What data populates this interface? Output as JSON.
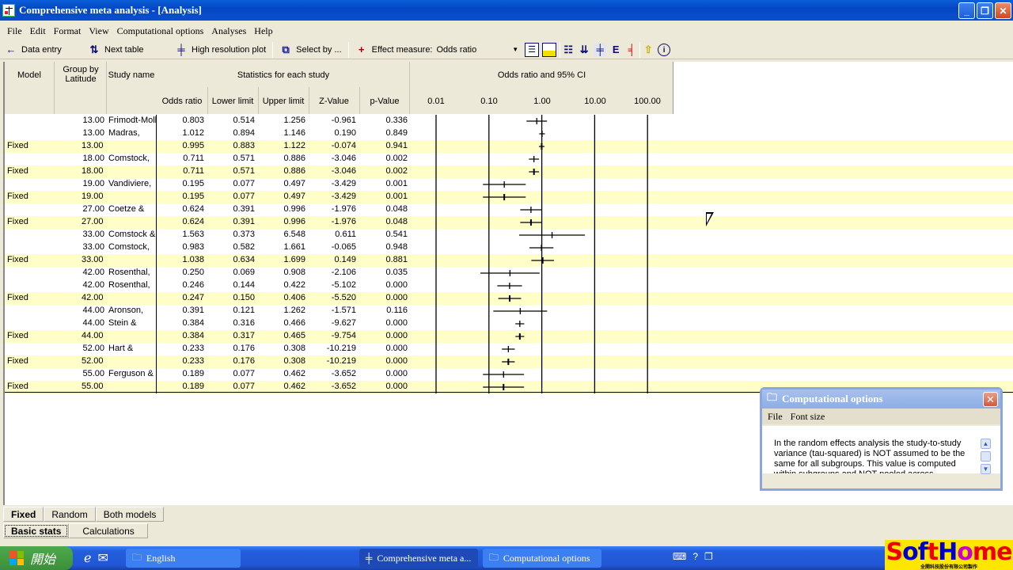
{
  "window": {
    "title": "Comprehensive meta analysis - [Analysis]"
  },
  "menu": [
    "File",
    "Edit",
    "Format",
    "View",
    "Computational options",
    "Analyses",
    "Help"
  ],
  "toolbar": {
    "data_entry": "Data entry",
    "next_table": "Next table",
    "high_res_plot": "High resolution plot",
    "select_by": "Select by ...",
    "effect_measure_label": "Effect measure:",
    "effect_measure_value": "Odds ratio"
  },
  "table": {
    "headers": {
      "model": "Model",
      "group": "Group by Latitude",
      "study": "Study name",
      "stats_group": "Statistics for each study",
      "odds_ratio": "Odds ratio",
      "lower": "Lower limit",
      "upper": "Upper limit",
      "z": "Z-Value",
      "p": "p-Value",
      "plot_title": "Odds ratio and 95% CI"
    },
    "axis_ticks": [
      "0.01",
      "0.10",
      "1.00",
      "10.00",
      "100.00"
    ],
    "rows": [
      {
        "model": "",
        "group": "13.00",
        "study": "Frimodt-Moll",
        "or": "0.803",
        "lo": "0.514",
        "hi": "1.256",
        "z": "-0.961",
        "p": "0.336"
      },
      {
        "model": "",
        "group": "13.00",
        "study": "Madras,",
        "or": "1.012",
        "lo": "0.894",
        "hi": "1.146",
        "z": "0.190",
        "p": "0.849"
      },
      {
        "model": "Fixed",
        "group": "13.00",
        "study": "",
        "or": "0.995",
        "lo": "0.883",
        "hi": "1.122",
        "z": "-0.074",
        "p": "0.941"
      },
      {
        "model": "",
        "group": "18.00",
        "study": "Comstock,",
        "or": "0.711",
        "lo": "0.571",
        "hi": "0.886",
        "z": "-3.046",
        "p": "0.002"
      },
      {
        "model": "Fixed",
        "group": "18.00",
        "study": "",
        "or": "0.711",
        "lo": "0.571",
        "hi": "0.886",
        "z": "-3.046",
        "p": "0.002"
      },
      {
        "model": "",
        "group": "19.00",
        "study": "Vandiviere,",
        "or": "0.195",
        "lo": "0.077",
        "hi": "0.497",
        "z": "-3.429",
        "p": "0.001"
      },
      {
        "model": "Fixed",
        "group": "19.00",
        "study": "",
        "or": "0.195",
        "lo": "0.077",
        "hi": "0.497",
        "z": "-3.429",
        "p": "0.001"
      },
      {
        "model": "",
        "group": "27.00",
        "study": "Coetze &",
        "or": "0.624",
        "lo": "0.391",
        "hi": "0.996",
        "z": "-1.976",
        "p": "0.048"
      },
      {
        "model": "Fixed",
        "group": "27.00",
        "study": "",
        "or": "0.624",
        "lo": "0.391",
        "hi": "0.996",
        "z": "-1.976",
        "p": "0.048"
      },
      {
        "model": "",
        "group": "33.00",
        "study": "Comstock &",
        "or": "1.563",
        "lo": "0.373",
        "hi": "6.548",
        "z": "0.611",
        "p": "0.541"
      },
      {
        "model": "",
        "group": "33.00",
        "study": "Comstock,",
        "or": "0.983",
        "lo": "0.582",
        "hi": "1.661",
        "z": "-0.065",
        "p": "0.948"
      },
      {
        "model": "Fixed",
        "group": "33.00",
        "study": "",
        "or": "1.038",
        "lo": "0.634",
        "hi": "1.699",
        "z": "0.149",
        "p": "0.881"
      },
      {
        "model": "",
        "group": "42.00",
        "study": "Rosenthal,",
        "or": "0.250",
        "lo": "0.069",
        "hi": "0.908",
        "z": "-2.106",
        "p": "0.035"
      },
      {
        "model": "",
        "group": "42.00",
        "study": "Rosenthal,",
        "or": "0.246",
        "lo": "0.144",
        "hi": "0.422",
        "z": "-5.102",
        "p": "0.000"
      },
      {
        "model": "Fixed",
        "group": "42.00",
        "study": "",
        "or": "0.247",
        "lo": "0.150",
        "hi": "0.406",
        "z": "-5.520",
        "p": "0.000"
      },
      {
        "model": "",
        "group": "44.00",
        "study": "Aronson,",
        "or": "0.391",
        "lo": "0.121",
        "hi": "1.262",
        "z": "-1.571",
        "p": "0.116"
      },
      {
        "model": "",
        "group": "44.00",
        "study": "Stein &",
        "or": "0.384",
        "lo": "0.316",
        "hi": "0.466",
        "z": "-9.627",
        "p": "0.000"
      },
      {
        "model": "Fixed",
        "group": "44.00",
        "study": "",
        "or": "0.384",
        "lo": "0.317",
        "hi": "0.465",
        "z": "-9.754",
        "p": "0.000"
      },
      {
        "model": "",
        "group": "52.00",
        "study": "Hart &",
        "or": "0.233",
        "lo": "0.176",
        "hi": "0.308",
        "z": "-10.219",
        "p": "0.000"
      },
      {
        "model": "Fixed",
        "group": "52.00",
        "study": "",
        "or": "0.233",
        "lo": "0.176",
        "hi": "0.308",
        "z": "-10.219",
        "p": "0.000"
      },
      {
        "model": "",
        "group": "55.00",
        "study": "Ferguson &",
        "or": "0.189",
        "lo": "0.077",
        "hi": "0.462",
        "z": "-3.652",
        "p": "0.000"
      },
      {
        "model": "Fixed",
        "group": "55.00",
        "study": "",
        "or": "0.189",
        "lo": "0.077",
        "hi": "0.462",
        "z": "-3.652",
        "p": "0.000"
      }
    ]
  },
  "chart_data": {
    "type": "scatter",
    "title": "Odds ratio and 95% CI",
    "xscale": "log",
    "xlim": [
      0.01,
      100
    ],
    "x_ticks": [
      "0.01",
      "0.10",
      "1.00",
      "10.00",
      "100.00"
    ],
    "points_source": "table.rows (or, lo, hi)"
  },
  "bottom_tabs": {
    "model": [
      "Fixed",
      "Random",
      "Both models"
    ],
    "view": [
      "Basic stats",
      "Calculations"
    ]
  },
  "dialog": {
    "title": "Computational options",
    "menu": [
      "File",
      "Font size"
    ],
    "body": "In the random effects analysis the study-to-study variance (tau-squared) is NOT assumed to be the same for all subgroups.  This value is computed within subgroups and NOT pooled across"
  },
  "taskbar": {
    "start": "開始",
    "items": [
      "English",
      "Comprehensive meta a...",
      "Computational options"
    ]
  },
  "watermark": {
    "brand": "SoftHome",
    "sub": "全開科技股份有限公司製作"
  }
}
